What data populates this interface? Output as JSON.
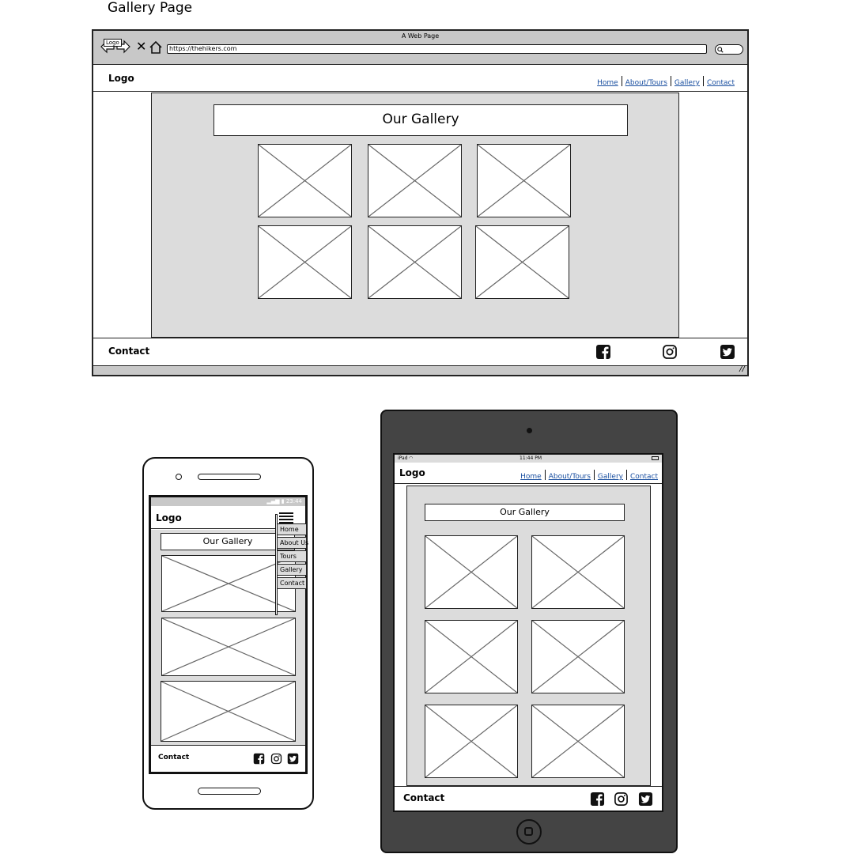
{
  "page_title": "Gallery Page",
  "desktop": {
    "window_title": "A Web Page",
    "address_bar_value": "https://thehikers.com",
    "back_forward_label": "Logo",
    "logo": "Logo",
    "nav": [
      "Home",
      "About/Tours",
      "Gallery",
      "Contact"
    ],
    "gallery_heading": "Our Gallery",
    "footer_contact": "Contact"
  },
  "mobile": {
    "status_time": "23:44",
    "logo": "Logo",
    "menu_items": [
      "Home",
      "About Us",
      "Tours",
      "Gallery",
      "Contact"
    ],
    "gallery_heading": "Our Gallery",
    "footer_contact": "Contact"
  },
  "tablet": {
    "status_device": "iPad",
    "status_time": "11:44 PM",
    "logo": "Logo",
    "nav": [
      "Home",
      "About/Tours",
      "Gallery",
      "Contact"
    ],
    "gallery_heading": "Our Gallery",
    "footer_contact": "Contact"
  },
  "icons": [
    "facebook-icon",
    "instagram-icon",
    "twitter-icon",
    "hamburger-menu-icon",
    "home-icon",
    "close-icon",
    "search-icon"
  ],
  "colors": {
    "panel_gray": "#dcdcdc",
    "chrome_gray": "#c8c8c8",
    "tablet_body": "#444444",
    "link_blue": "#1a4fa0"
  }
}
